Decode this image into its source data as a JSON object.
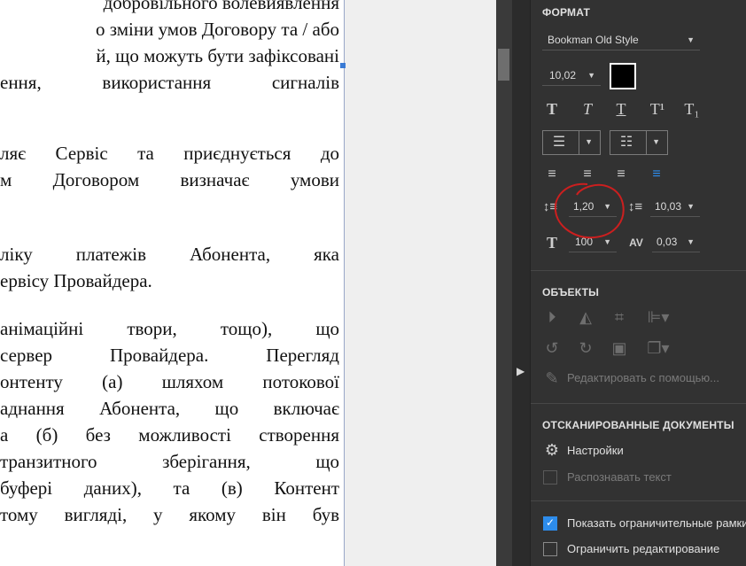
{
  "document": {
    "lines": [
      {
        "text": "добровільного волевиявлення",
        "style": "right"
      },
      {
        "text": "о зміни умов Договору та / або",
        "style": "right"
      },
      {
        "text": "й, що можуть бути зафіксовані",
        "style": "right"
      },
      {
        "text": "ення, використання сигналів",
        "style": "just"
      },
      {
        "text": "",
        "style": "right"
      },
      {
        "text": "ляє Сервіс та приєднується до",
        "style": "just"
      },
      {
        "text": "м Договором визначає умови",
        "style": "just"
      },
      {
        "text": "",
        "style": "right"
      },
      {
        "text": "ліку платежів Абонента, яка",
        "style": "just"
      },
      {
        "text": "ервісу Провайдера.",
        "style": "left"
      },
      {
        "text": "",
        "style": "right"
      },
      {
        "text": "анімаційні твори, тощо), що",
        "style": "just"
      },
      {
        "text": "сервер Провайдера. Перегляд",
        "style": "just"
      },
      {
        "text": "онтенту (а) шляхом потокової",
        "style": "just"
      },
      {
        "text": "аднання Абонента, що включає",
        "style": "just"
      },
      {
        "text": "а (б) без можливості створення",
        "style": "just"
      },
      {
        "text": " транзитного зберігання, що",
        "style": "just"
      },
      {
        "text": " буфері даних), та (в) Контент",
        "style": "just"
      },
      {
        "text": " тому вигляді, у якому він був",
        "style": "just"
      }
    ]
  },
  "panel": {
    "format_title": "ФОРМАТ",
    "font_family": "Bookman Old Style",
    "font_size": "10,02",
    "text_color": "#000000",
    "line_spacing": "1,20",
    "paragraph_spacing": "10,03",
    "horizontal_scale": "100",
    "char_spacing": "0,03",
    "objects_title": "ОБЪЕКТЫ",
    "edit_with_label": "Редактировать с помощью...",
    "scanned_title": "ОТСКАНИРОВАННЫЕ ДОКУМЕНТЫ",
    "settings_label": "Настройки",
    "recognize_label": "Распознавать текст",
    "show_bounds_label": "Показать ограничительные рамки",
    "restrict_edit_label": "Ограничить редактирование",
    "show_bounds_checked": true,
    "restrict_edit_checked": false,
    "accent_color": "#2d8ceb",
    "annotation_color": "#cc1f1f"
  }
}
